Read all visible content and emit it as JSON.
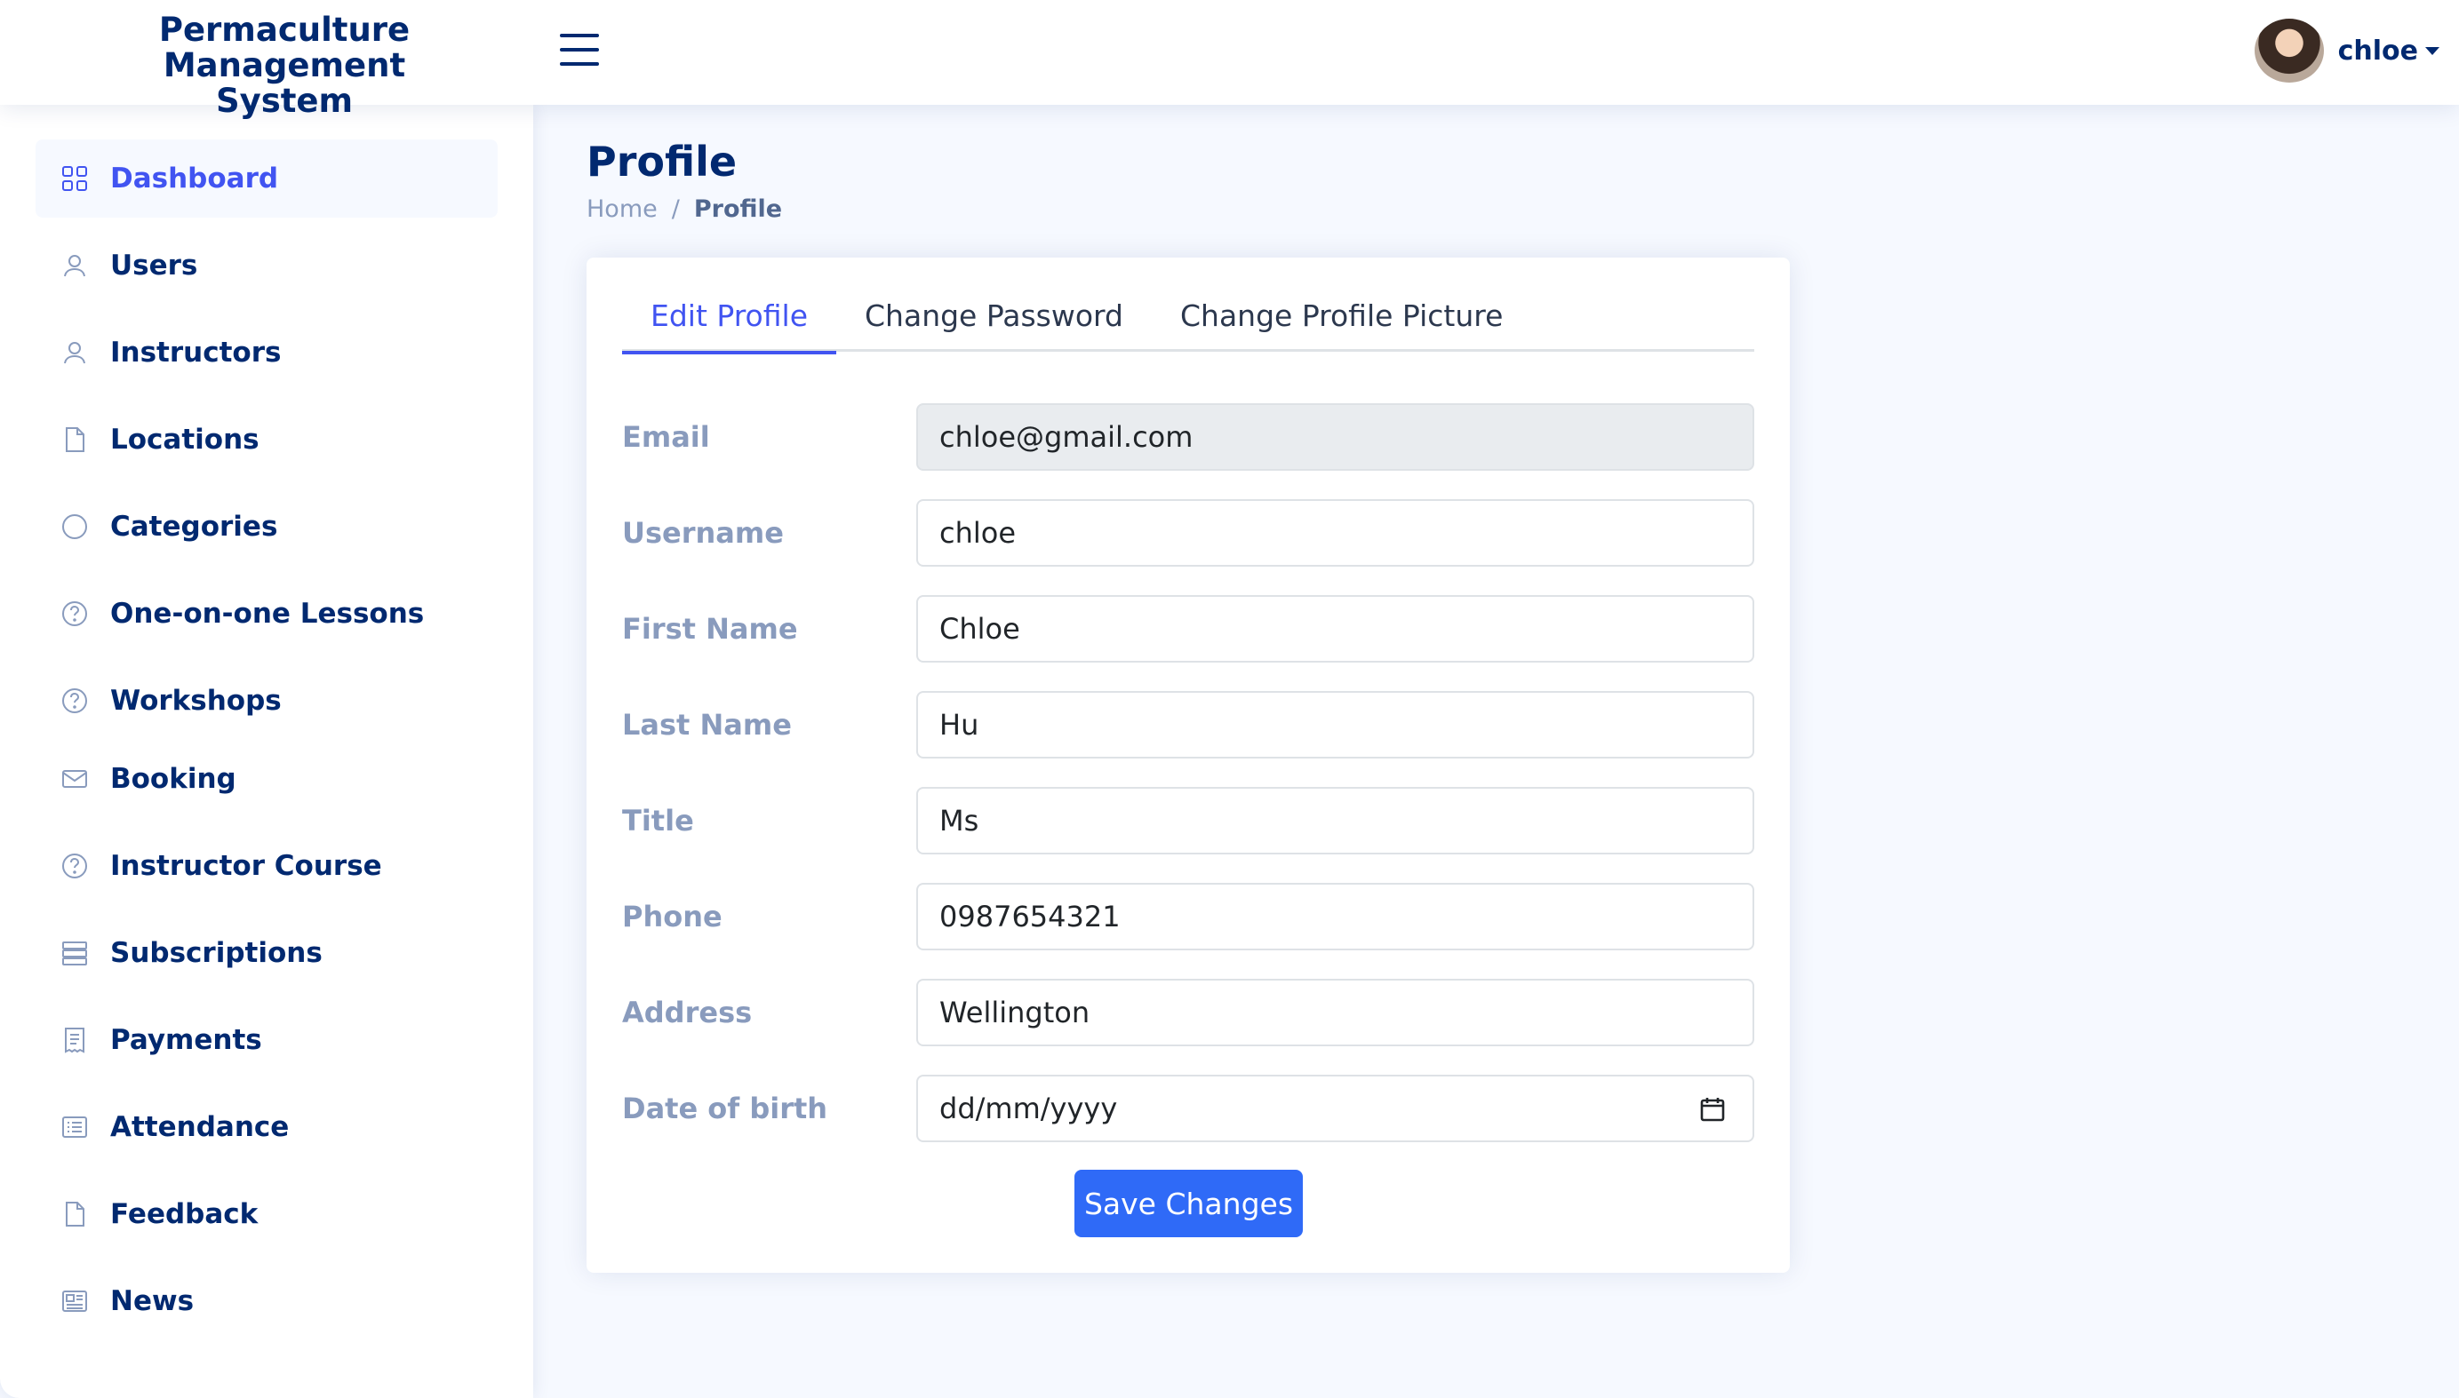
{
  "header": {
    "logo_line1": "Permaculture Management",
    "logo_line2": "System",
    "user_name": "chloe"
  },
  "sidebar": {
    "items": [
      {
        "label": "Dashboard",
        "icon": "grid-icon"
      },
      {
        "label": "Users",
        "icon": "person-icon"
      },
      {
        "label": "Instructors",
        "icon": "person-icon"
      },
      {
        "label": "Locations",
        "icon": "file-icon"
      },
      {
        "label": "Categories",
        "icon": "circle-icon"
      },
      {
        "label": "One-on-one Lessons",
        "icon": "question-circle-icon"
      },
      {
        "label": "Workshops",
        "icon": "question-circle-icon"
      },
      {
        "label": "Booking",
        "icon": "envelope-icon"
      },
      {
        "label": "Instructor Course",
        "icon": "question-circle-icon"
      },
      {
        "label": "Subscriptions",
        "icon": "layers-icon"
      },
      {
        "label": "Payments",
        "icon": "receipt-icon"
      },
      {
        "label": "Attendance",
        "icon": "list-icon"
      },
      {
        "label": "Feedback",
        "icon": "file-icon"
      },
      {
        "label": "News",
        "icon": "newspaper-icon"
      }
    ]
  },
  "page": {
    "title": "Profile",
    "breadcrumb": {
      "home": "Home",
      "separator": "/",
      "current": "Profile"
    }
  },
  "tabs": [
    "Edit Profile",
    "Change Password",
    "Change Profile Picture"
  ],
  "form": {
    "fields": [
      {
        "label": "Email",
        "value": "chloe@gmail.com"
      },
      {
        "label": "Username",
        "value": "chloe"
      },
      {
        "label": "First Name",
        "value": "Chloe"
      },
      {
        "label": "Last Name",
        "value": "Hu"
      },
      {
        "label": "Title",
        "value": "Ms"
      },
      {
        "label": "Phone",
        "value": "0987654321"
      },
      {
        "label": "Address",
        "value": "Wellington"
      },
      {
        "label": "Date of birth",
        "value": "dd/mm/yyyy"
      }
    ],
    "save_label": "Save Changes"
  },
  "colors": {
    "primary": "#4154f1",
    "navy": "#012970",
    "button": "#2f6af7",
    "label": "#899bbd",
    "background": "#f6f9ff"
  }
}
